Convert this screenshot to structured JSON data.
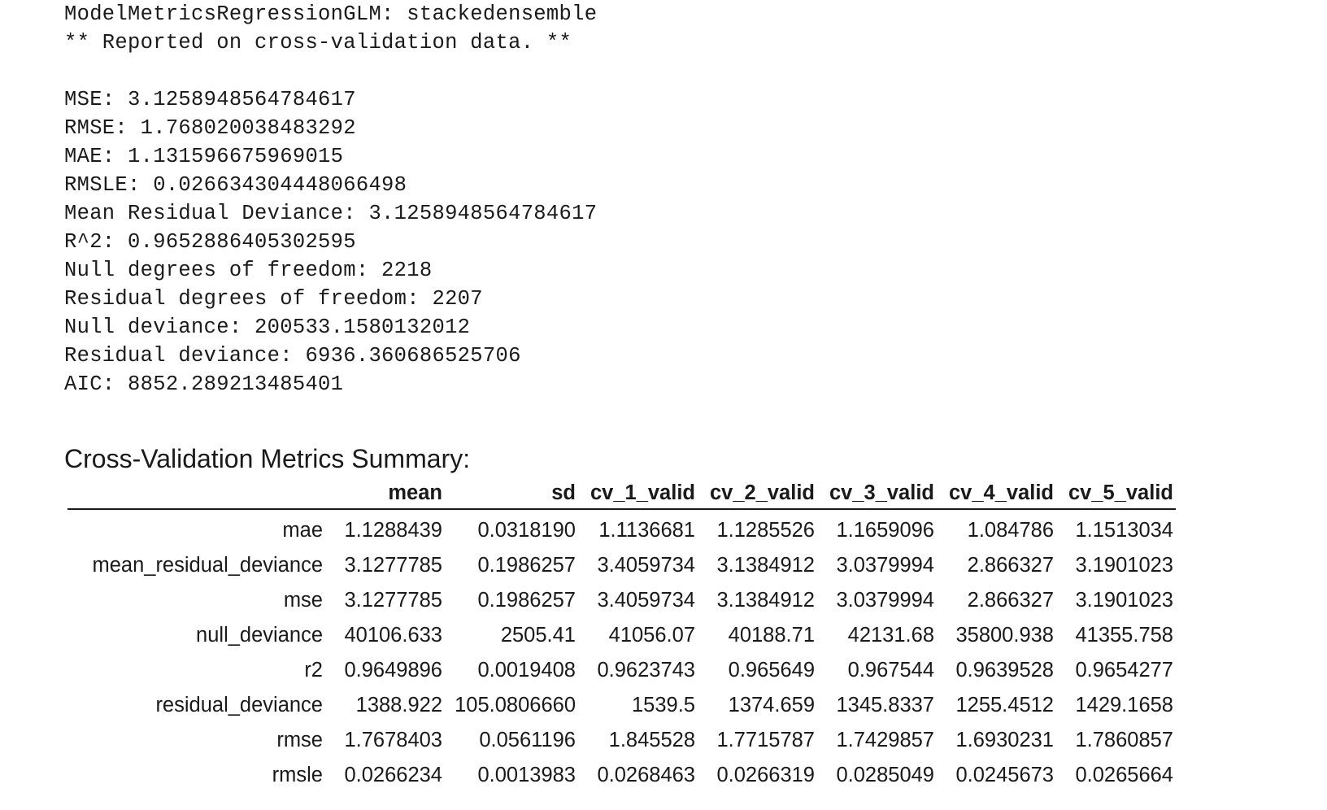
{
  "model_metrics": {
    "header": "ModelMetricsRegressionGLM: stackedensemble",
    "note": "** Reported on cross-validation data. **",
    "lines": [
      "MSE: 3.1258948564784617",
      "RMSE: 1.768020038483292",
      "MAE: 1.131596675969015",
      "RMSLE: 0.026634304448066498",
      "Mean Residual Deviance: 3.1258948564784617",
      "R^2: 0.9652886405302595",
      "Null degrees of freedom: 2218",
      "Residual degrees of freedom: 2207",
      "Null deviance: 200533.1580132012",
      "Residual deviance: 6936.360686525706",
      "AIC: 8852.289213485401"
    ]
  },
  "summary": {
    "title": "Cross-Validation Metrics Summary:",
    "columns": [
      "",
      "mean",
      "sd",
      "cv_1_valid",
      "cv_2_valid",
      "cv_3_valid",
      "cv_4_valid",
      "cv_5_valid"
    ],
    "rows": [
      [
        "mae",
        "1.1288439",
        "0.0318190",
        "1.1136681",
        "1.1285526",
        "1.1659096",
        "1.084786",
        "1.1513034"
      ],
      [
        "mean_residual_deviance",
        "3.1277785",
        "0.1986257",
        "3.4059734",
        "3.1384912",
        "3.0379994",
        "2.866327",
        "3.1901023"
      ],
      [
        "mse",
        "3.1277785",
        "0.1986257",
        "3.4059734",
        "3.1384912",
        "3.0379994",
        "2.866327",
        "3.1901023"
      ],
      [
        "null_deviance",
        "40106.633",
        "2505.41",
        "41056.07",
        "40188.71",
        "42131.68",
        "35800.938",
        "41355.758"
      ],
      [
        "r2",
        "0.9649896",
        "0.0019408",
        "0.9623743",
        "0.965649",
        "0.967544",
        "0.9639528",
        "0.9654277"
      ],
      [
        "residual_deviance",
        "1388.922",
        "105.0806660",
        "1539.5",
        "1374.659",
        "1345.8337",
        "1255.4512",
        "1429.1658"
      ],
      [
        "rmse",
        "1.7678403",
        "0.0561196",
        "1.845528",
        "1.7715787",
        "1.7429857",
        "1.6930231",
        "1.7860857"
      ],
      [
        "rmsle",
        "0.0266234",
        "0.0013983",
        "0.0268463",
        "0.0266319",
        "0.0285049",
        "0.0245673",
        "0.0265664"
      ]
    ]
  }
}
